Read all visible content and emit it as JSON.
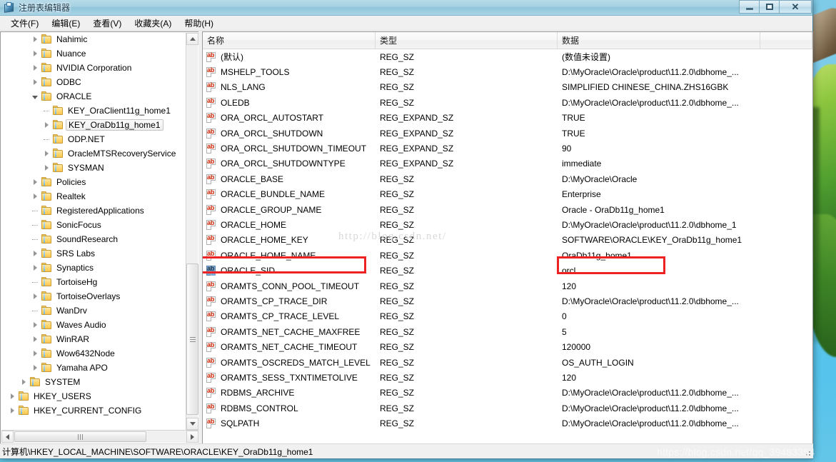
{
  "window": {
    "title": "注册表编辑器",
    "icon": "registry-editor-icon",
    "buttons": {
      "minimize": "最小化",
      "maximize": "最大化",
      "close": "关闭"
    }
  },
  "menubar": [
    {
      "label": "文件(F)"
    },
    {
      "label": "编辑(E)"
    },
    {
      "label": "查看(V)"
    },
    {
      "label": "收藏夹(A)"
    },
    {
      "label": "帮助(H)"
    }
  ],
  "tree": [
    {
      "label": "Nahimic",
      "indent": 2,
      "expander": "collapsed",
      "selected": false
    },
    {
      "label": "Nuance",
      "indent": 2,
      "expander": "collapsed",
      "selected": false
    },
    {
      "label": "NVIDIA Corporation",
      "indent": 2,
      "expander": "collapsed",
      "selected": false
    },
    {
      "label": "ODBC",
      "indent": 2,
      "expander": "collapsed",
      "selected": false
    },
    {
      "label": "ORACLE",
      "indent": 2,
      "expander": "expanded",
      "selected": false
    },
    {
      "label": "KEY_OraClient11g_home1",
      "indent": 3,
      "expander": "none",
      "selected": false
    },
    {
      "label": "KEY_OraDb11g_home1",
      "indent": 3,
      "expander": "collapsed",
      "selected": true
    },
    {
      "label": "ODP.NET",
      "indent": 3,
      "expander": "none",
      "selected": false
    },
    {
      "label": "OracleMTSRecoveryService",
      "indent": 3,
      "expander": "collapsed",
      "selected": false
    },
    {
      "label": "SYSMAN",
      "indent": 3,
      "expander": "collapsed",
      "selected": false
    },
    {
      "label": "Policies",
      "indent": 2,
      "expander": "collapsed",
      "selected": false
    },
    {
      "label": "Realtek",
      "indent": 2,
      "expander": "collapsed",
      "selected": false
    },
    {
      "label": "RegisteredApplications",
      "indent": 2,
      "expander": "none",
      "selected": false
    },
    {
      "label": "SonicFocus",
      "indent": 2,
      "expander": "none",
      "selected": false
    },
    {
      "label": "SoundResearch",
      "indent": 2,
      "expander": "none",
      "selected": false
    },
    {
      "label": "SRS Labs",
      "indent": 2,
      "expander": "collapsed",
      "selected": false
    },
    {
      "label": "Synaptics",
      "indent": 2,
      "expander": "collapsed",
      "selected": false
    },
    {
      "label": "TortoiseHg",
      "indent": 2,
      "expander": "none",
      "selected": false
    },
    {
      "label": "TortoiseOverlays",
      "indent": 2,
      "expander": "collapsed",
      "selected": false
    },
    {
      "label": "WanDrv",
      "indent": 2,
      "expander": "none",
      "selected": false
    },
    {
      "label": "Waves Audio",
      "indent": 2,
      "expander": "collapsed",
      "selected": false
    },
    {
      "label": "WinRAR",
      "indent": 2,
      "expander": "collapsed",
      "selected": false
    },
    {
      "label": "Wow6432Node",
      "indent": 2,
      "expander": "collapsed",
      "selected": false
    },
    {
      "label": "Yamaha APO",
      "indent": 2,
      "expander": "collapsed",
      "selected": false
    },
    {
      "label": "SYSTEM",
      "indent": 1,
      "expander": "collapsed",
      "selected": false
    },
    {
      "label": "HKEY_USERS",
      "indent": 0,
      "expander": "collapsed",
      "selected": false
    },
    {
      "label": "HKEY_CURRENT_CONFIG",
      "indent": 0,
      "expander": "collapsed",
      "selected": false
    }
  ],
  "list": {
    "columns": [
      {
        "label": "名称"
      },
      {
        "label": "类型"
      },
      {
        "label": "数据"
      },
      {
        "label": ""
      }
    ],
    "rows": [
      {
        "name": "(默认)",
        "type": "REG_SZ",
        "data": "(数值未设置)",
        "icon": "string-value-icon",
        "selected": false
      },
      {
        "name": "MSHELP_TOOLS",
        "type": "REG_SZ",
        "data": "D:\\MyOracle\\Oracle\\product\\11.2.0\\dbhome_...",
        "icon": "string-value-icon",
        "selected": false
      },
      {
        "name": "NLS_LANG",
        "type": "REG_SZ",
        "data": "SIMPLIFIED CHINESE_CHINA.ZHS16GBK",
        "icon": "string-value-icon",
        "selected": false
      },
      {
        "name": "OLEDB",
        "type": "REG_SZ",
        "data": "D:\\MyOracle\\Oracle\\product\\11.2.0\\dbhome_...",
        "icon": "string-value-icon",
        "selected": false
      },
      {
        "name": "ORA_ORCL_AUTOSTART",
        "type": "REG_EXPAND_SZ",
        "data": "TRUE",
        "icon": "string-value-icon",
        "selected": false
      },
      {
        "name": "ORA_ORCL_SHUTDOWN",
        "type": "REG_EXPAND_SZ",
        "data": "TRUE",
        "icon": "string-value-icon",
        "selected": false
      },
      {
        "name": "ORA_ORCL_SHUTDOWN_TIMEOUT",
        "type": "REG_EXPAND_SZ",
        "data": "90",
        "icon": "string-value-icon",
        "selected": false
      },
      {
        "name": "ORA_ORCL_SHUTDOWNTYPE",
        "type": "REG_EXPAND_SZ",
        "data": "immediate",
        "icon": "string-value-icon",
        "selected": false
      },
      {
        "name": "ORACLE_BASE",
        "type": "REG_SZ",
        "data": "D:\\MyOracle\\Oracle",
        "icon": "string-value-icon",
        "selected": false
      },
      {
        "name": "ORACLE_BUNDLE_NAME",
        "type": "REG_SZ",
        "data": "Enterprise",
        "icon": "string-value-icon",
        "selected": false
      },
      {
        "name": "ORACLE_GROUP_NAME",
        "type": "REG_SZ",
        "data": "Oracle - OraDb11g_home1",
        "icon": "string-value-icon",
        "selected": false
      },
      {
        "name": "ORACLE_HOME",
        "type": "REG_SZ",
        "data": "D:\\MyOracle\\Oracle\\product\\11.2.0\\dbhome_1",
        "icon": "string-value-icon",
        "selected": false
      },
      {
        "name": "ORACLE_HOME_KEY",
        "type": "REG_SZ",
        "data": "SOFTWARE\\ORACLE\\KEY_OraDb11g_home1",
        "icon": "string-value-icon",
        "selected": false
      },
      {
        "name": "ORACLE_HOME_NAME",
        "type": "REG_SZ",
        "data": "OraDb11g_home1",
        "icon": "string-value-icon",
        "selected": false
      },
      {
        "name": "ORACLE_SID",
        "type": "REG_SZ",
        "data": "orcl",
        "icon": "string-value-icon",
        "selected": true
      },
      {
        "name": "ORAMTS_CONN_POOL_TIMEOUT",
        "type": "REG_SZ",
        "data": "120",
        "icon": "string-value-icon",
        "selected": false
      },
      {
        "name": "ORAMTS_CP_TRACE_DIR",
        "type": "REG_SZ",
        "data": "D:\\MyOracle\\Oracle\\product\\11.2.0\\dbhome_...",
        "icon": "string-value-icon",
        "selected": false
      },
      {
        "name": "ORAMTS_CP_TRACE_LEVEL",
        "type": "REG_SZ",
        "data": "0",
        "icon": "string-value-icon",
        "selected": false
      },
      {
        "name": "ORAMTS_NET_CACHE_MAXFREE",
        "type": "REG_SZ",
        "data": "5",
        "icon": "string-value-icon",
        "selected": false
      },
      {
        "name": "ORAMTS_NET_CACHE_TIMEOUT",
        "type": "REG_SZ",
        "data": "120000",
        "icon": "string-value-icon",
        "selected": false
      },
      {
        "name": "ORAMTS_OSCREDS_MATCH_LEVEL",
        "type": "REG_SZ",
        "data": "OS_AUTH_LOGIN",
        "icon": "string-value-icon",
        "selected": false
      },
      {
        "name": "ORAMTS_SESS_TXNTIMETOLIVE",
        "type": "REG_SZ",
        "data": "120",
        "icon": "string-value-icon",
        "selected": false
      },
      {
        "name": "RDBMS_ARCHIVE",
        "type": "REG_SZ",
        "data": "D:\\MyOracle\\Oracle\\product\\11.2.0\\dbhome_...",
        "icon": "string-value-icon",
        "selected": false
      },
      {
        "name": "RDBMS_CONTROL",
        "type": "REG_SZ",
        "data": "D:\\MyOracle\\Oracle\\product\\11.2.0\\dbhome_...",
        "icon": "string-value-icon",
        "selected": false
      },
      {
        "name": "SQLPATH",
        "type": "REG_SZ",
        "data": "D:\\MyOracle\\Oracle\\product\\11.2.0\\dbhome_...",
        "icon": "string-value-icon",
        "selected": false
      }
    ]
  },
  "statusbar": {
    "path": "计算机\\HKEY_LOCAL_MACHINE\\SOFTWARE\\ORACLE\\KEY_OraDb11g_home1"
  },
  "watermarks": {
    "list_overlay": "http://blog.csdn.net/",
    "bottom_right": "https://blog.csdn.net/qq_39483354"
  },
  "annotations": {
    "highlight_color": "#ee2222",
    "boxes": [
      {
        "target": "ORACLE_SID name cell"
      },
      {
        "target": "orcl data cell"
      }
    ]
  }
}
